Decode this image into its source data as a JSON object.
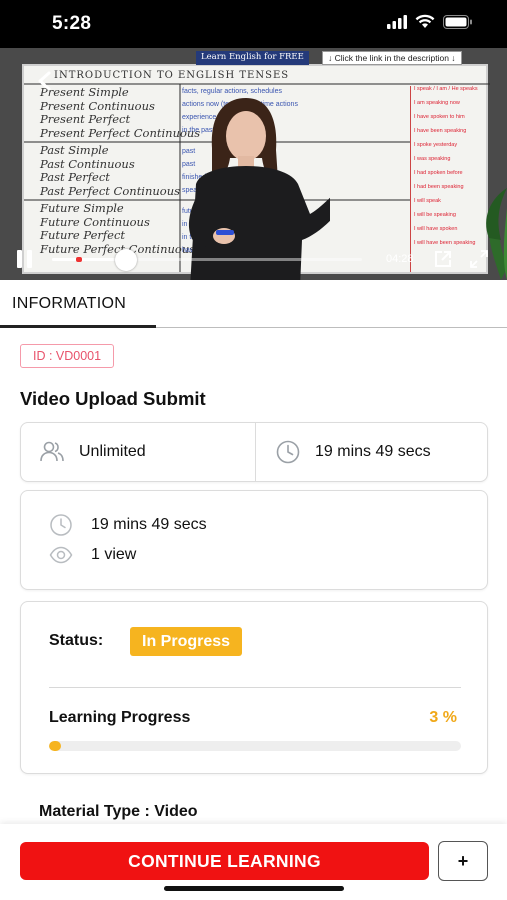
{
  "status_bar": {
    "time": "5:28"
  },
  "video": {
    "banner_left": "Learn English for FREE",
    "banner_right": "↓ Click the link in the description ↓",
    "board_title": "INTRODUCTION TO ENGLISH TENSES",
    "board_groups": [
      [
        "Present Simple",
        "Present Continuous",
        "Present Perfect",
        "Present Perfect Continuous"
      ],
      [
        "Past Simple",
        "Past Continuous",
        "Past Perfect",
        "Past Perfect Continuous"
      ],
      [
        "Future Simple",
        "Future Continuous",
        "Future Perfect",
        "Future Perfect Continuous"
      ]
    ],
    "board_notes": [
      "facts, regular actions, schedules",
      "actions now (temp.), one time actions",
      "experience (or back then)",
      "in the past and continue",
      "past",
      "past",
      "finished in the past",
      "speak in the past",
      "future",
      "in the future",
      "in the future",
      "have started, probably at the future"
    ],
    "board_red_notes": [
      "I speak / I am / He speaks",
      "I am speaking now",
      "I have spoken to him",
      "I have been speaking",
      "I spoke yesterday",
      "I was speaking",
      "I had spoken before",
      "I had been speaking",
      "I will speak",
      "I will be speaking",
      "I will have spoken",
      "I will have been speaking"
    ],
    "duration": "04:28",
    "progress": 0.24
  },
  "tabs": [
    {
      "label": "INFORMATION",
      "active": true
    }
  ],
  "content": {
    "id_badge": "ID : VD0001",
    "title": "Video Upload Submit",
    "attendees": "Unlimited",
    "duration_summary": "19 mins 49 secs",
    "duration_detail": "19 mins 49 secs",
    "views": "1 view",
    "status_label": "Status:",
    "status_value": "In Progress",
    "learning_progress_label": "Learning Progress",
    "learning_progress_value": "3 %",
    "learning_progress_fraction": 0.03,
    "material_type": "Material Type :  Video"
  },
  "bottom": {
    "continue_label": "CONTINUE LEARNING",
    "plus_label": "+"
  },
  "colors": {
    "accent_red": "#f01212",
    "status_amber": "#f6b41f",
    "badge_pink": "#e8536b"
  }
}
